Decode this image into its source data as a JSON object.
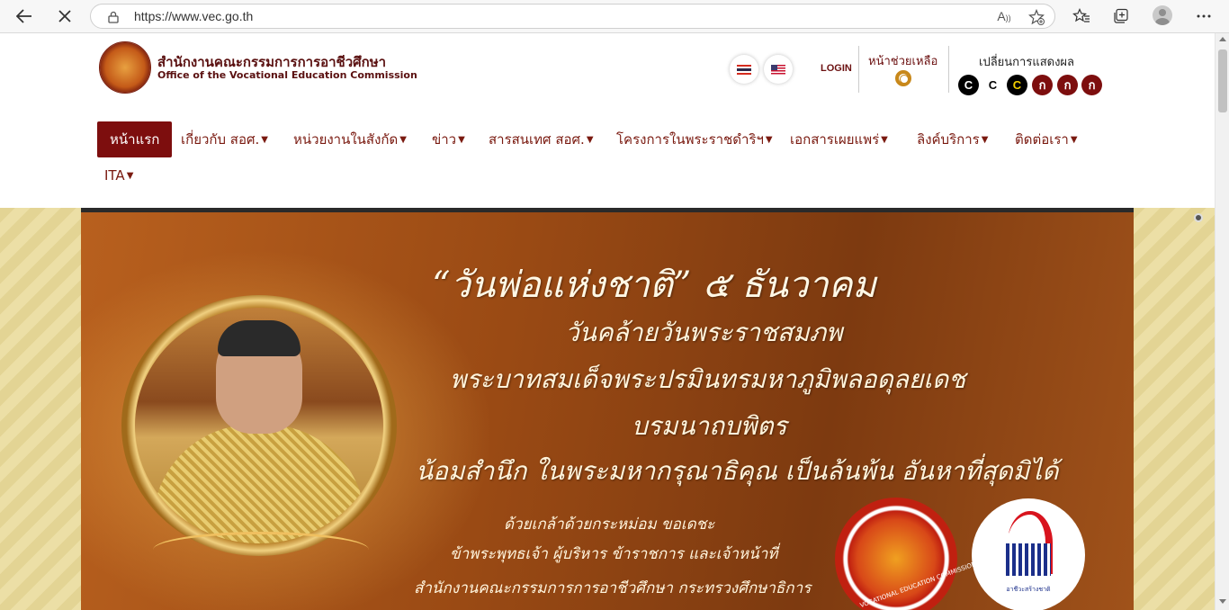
{
  "browser": {
    "url": "https://www.vec.go.th",
    "back_icon": "back-arrow-icon",
    "stop_icon": "close-icon",
    "read_aloud_label": "A",
    "tools": [
      "read-aloud-icon",
      "favorite-add-icon",
      "favorites-icon",
      "collections-icon",
      "profile-avatar",
      "more-icon"
    ]
  },
  "header": {
    "logo_th": "สำนักงานคณะกรรมการการอาชีวศึกษา",
    "logo_en": "Office of the Vocational Education Commission",
    "login": "LOGIN",
    "help": "หน้าช่วยเหลือ",
    "display": "เปลี่ยนการแสดงผล",
    "contrast_buttons": [
      {
        "label": "C",
        "bg": "#000000",
        "fg": "#ffffff"
      },
      {
        "label": "C",
        "bg": "#ffffff",
        "fg": "#000000"
      },
      {
        "label": "C",
        "bg": "#000000",
        "fg": "#f5d000"
      },
      {
        "label": "ก",
        "bg": "#7d0e0e",
        "fg": "#ffffff"
      },
      {
        "label": "ก",
        "bg": "#7d0e0e",
        "fg": "#ffffff"
      },
      {
        "label": "ก",
        "bg": "#7d0e0e",
        "fg": "#ffffff"
      }
    ]
  },
  "menu": {
    "items": [
      {
        "label": "หน้าแรก",
        "caret": ""
      },
      {
        "label": "เกี่ยวกับ สอศ.",
        "caret": "▼"
      },
      {
        "label": "หน่วยงานในสังกัด",
        "caret": "▼"
      },
      {
        "label": "ข่าว",
        "caret": "▼"
      },
      {
        "label": "สารสนเทศ สอศ.",
        "caret": "▼"
      },
      {
        "label": "โครงการในพระราชดำริฯ",
        "caret": "▼"
      },
      {
        "label": "เอกสารเผยแพร่",
        "caret": "▼"
      },
      {
        "label": "ลิงค์บริการ",
        "caret": "▼"
      },
      {
        "label": "ติดต่อเรา",
        "caret": "▼"
      },
      {
        "label": "ITA",
        "caret": "▼"
      }
    ]
  },
  "banner": {
    "title": "“วันพ่อแห่งชาติ” ๕ ธันวาคม",
    "line1": "วันคล้ายวันพระราชสมภพ",
    "line2": "พระบาทสมเด็จพระปรมินทรมหาภูมิพลอดุลยเดช",
    "line3": "บรมนาถบพิตร",
    "line4": "น้อมสำนึก ในพระมหากรุณาธิคุณ เป็นล้นพ้น อันหาที่สุดมิได้",
    "small1": "ด้วยเกล้าด้วยกระหม่อม ขอเดชะ",
    "small2": "ข้าพระพุทธเจ้า ผู้บริหาร ข้าราชการ และเจ้าหน้าที่",
    "small3": "สำนักงานคณะกรรมการการอาชีวศึกษา กระทรวงศึกษาธิการ",
    "seal_text": "VOCATIONAL EDUCATION COMMISSION",
    "seal2_text": "อาชีวะสร้างชาติ"
  },
  "colors": {
    "brand": "#7d0e0e",
    "banner": "#9a4a14",
    "side_pattern": "#e3d494"
  }
}
